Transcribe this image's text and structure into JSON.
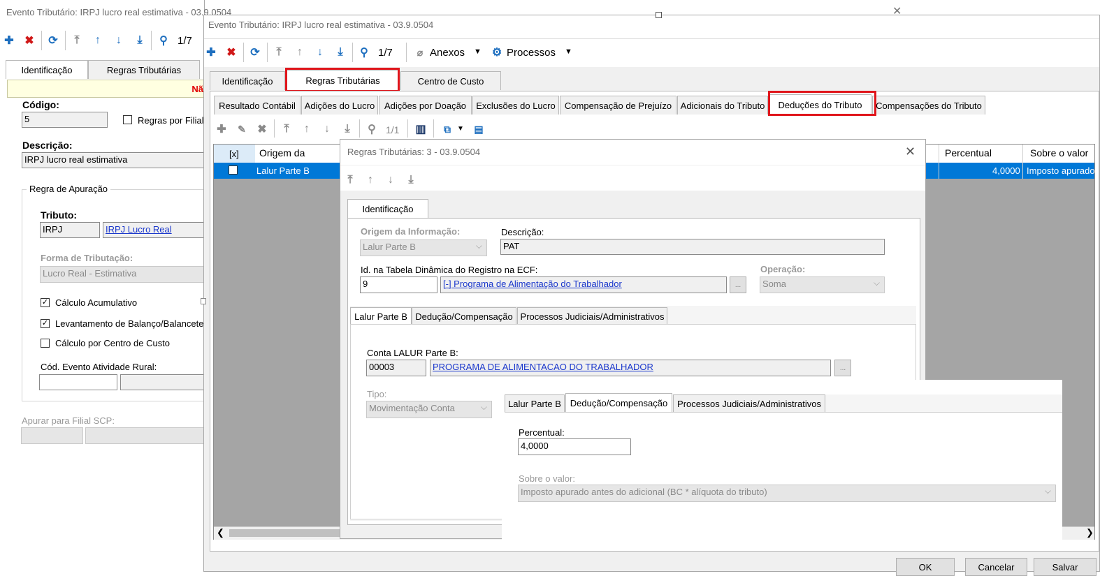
{
  "back_window": {
    "title": "Evento Tributário: IRPJ lucro real estimativa - 03.9.0504",
    "nav_counter": "1/7",
    "tabs": [
      "Identificação",
      "Regras Tributárias"
    ],
    "warning_text": "Nã",
    "codigo_label": "Código:",
    "codigo_value": "5",
    "regras_por_filial_label": "Regras por Filial",
    "descricao_label": "Descrição:",
    "descricao_value": "IRPJ lucro real estimativa",
    "regra_group_label": "Regra de Apuração",
    "tributo_label": "Tributo:",
    "tributo_code": "IRPJ",
    "tributo_name": "IRPJ Lucro Real",
    "forma_label": "Forma de Tributação:",
    "forma_value": "Lucro Real - Estimativa",
    "calculo_acumulativo": "Cálculo Acumulativo",
    "levantamento": "Levantamento de Balanço/Balancete",
    "calculo_centro": "Cálculo por Centro de Custo",
    "cod_evento_label": "Cód. Evento Atividade Rural:",
    "apurar_label": "Apurar para Filial SCP:"
  },
  "main_window": {
    "title": "Evento Tributário: IRPJ lucro real estimativa - 03.9.0504",
    "nav_counter": "1/7",
    "anexos": "Anexos",
    "processos": "Processos",
    "tabs": [
      "Identificação",
      "Regras Tributárias",
      "Centro de Custo"
    ],
    "subtabs": [
      "Resultado Contábil",
      "Adições do Lucro",
      "Adições por Doação",
      "Exclusões do Lucro",
      "Compensação de Prejuízo",
      "Adicionais do Tributo",
      "Deduções do Tributo",
      "Compensações do Tributo"
    ],
    "grid_counter": "1/1",
    "grid_headers": [
      "[x]",
      "Origem da",
      "Percentual",
      "Sobre o valor"
    ],
    "grid_row": {
      "origem": "Lalur Parte B",
      "percentual": "4,0000",
      "sobre": "Imposto apurado"
    },
    "buttons": {
      "ok": "OK",
      "cancel": "Cancelar",
      "save": "Salvar"
    }
  },
  "dialog": {
    "title": "Regras Tributárias: 3 - 03.9.0504",
    "tab": "Identificação",
    "origem_label": "Origem da Informação:",
    "origem_value": "Lalur Parte B",
    "descricao_label": "Descrição:",
    "descricao_value": "PAT",
    "id_tabela_label": "Id. na Tabela Dinâmica do Registro na ECF:",
    "id_tabela_code": "9",
    "id_tabela_link": "[-] Programa de Alimentação do Trabalhador",
    "operacao_label": "Operação:",
    "operacao_value": "Soma",
    "inner_tabs": [
      "Lalur Parte B",
      "Dedução/Compensação",
      "Processos Judiciais/Administrativos"
    ],
    "conta_label": "Conta LALUR Parte B:",
    "conta_code": "00003",
    "conta_link": "PROGRAMA DE ALIMENTACAO DO TRABALHADOR",
    "tipo_label": "Tipo:",
    "tipo_value": "Movimentação Conta"
  },
  "overlay": {
    "tabs": [
      "Lalur Parte B",
      "Dedução/Compensação",
      "Processos Judiciais/Administrativos"
    ],
    "percentual_label": "Percentual:",
    "percentual_value": "4,0000",
    "sobre_label": "Sobre o valor:",
    "sobre_value": "Imposto apurado antes do adicional (BC * alíquota do tributo)"
  },
  "colors": {
    "accent_blue": "#1e6fbf",
    "delete_red": "#d01818",
    "highlight_red": "#e0161c",
    "selection_blue": "#0078d7"
  }
}
